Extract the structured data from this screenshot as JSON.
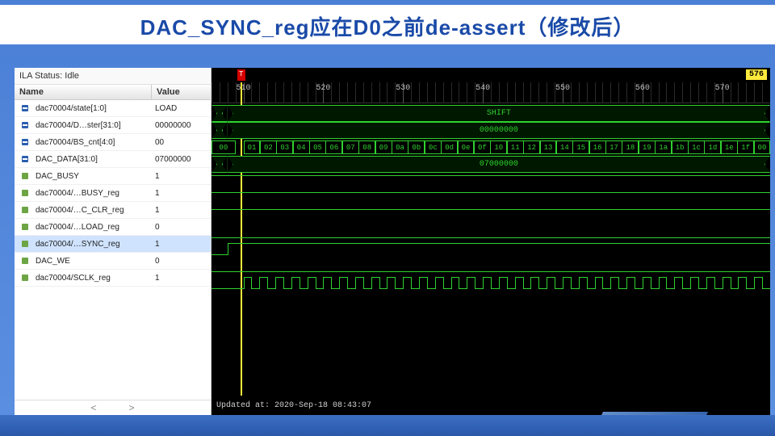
{
  "slide": {
    "title": "DAC_SYNC_reg应在D0之前de-assert（修改后）"
  },
  "ila": {
    "status_label": "ILA Status:",
    "status_value": "Idle"
  },
  "columns": {
    "name": "Name",
    "value": "Value"
  },
  "signals": [
    {
      "icon": "bus",
      "name": "dac70004/state[1:0]",
      "value": "LOAD",
      "type": "bus",
      "seg_label": "SHIFT"
    },
    {
      "icon": "bus",
      "name": "dac70004/D…ster[31:0]",
      "value": "00000000",
      "type": "bus",
      "seg_label": "00000000"
    },
    {
      "icon": "bus",
      "name": "dac70004/BS_cnt[4:0]",
      "value": "00",
      "type": "hexcount"
    },
    {
      "icon": "bus",
      "name": "DAC_DATA[31:0]",
      "value": "07000000",
      "type": "bus",
      "seg_label": "07000000"
    },
    {
      "icon": "sig",
      "name": "DAC_BUSY",
      "value": "1",
      "type": "bit",
      "level": "high"
    },
    {
      "icon": "sig",
      "name": "dac70004/…BUSY_reg",
      "value": "1",
      "type": "bit",
      "level": "high"
    },
    {
      "icon": "sig",
      "name": "dac70004/…C_CLR_reg",
      "value": "1",
      "type": "bit",
      "level": "high"
    },
    {
      "icon": "sig",
      "name": "dac70004/…LOAD_reg",
      "value": "0",
      "type": "bit",
      "level": "low"
    },
    {
      "icon": "sig",
      "name": "dac70004/…SYNC_reg",
      "value": "1",
      "type": "bit",
      "level": "stephigh",
      "selected": true
    },
    {
      "icon": "sig",
      "name": "DAC_WE",
      "value": "0",
      "type": "bit",
      "level": "low"
    },
    {
      "icon": "sig",
      "name": "dac70004/SCLK_reg",
      "value": "1",
      "type": "clock"
    }
  ],
  "ruler": {
    "cursor_badge": "576",
    "majors": [
      510,
      520,
      530,
      540,
      550,
      560,
      570
    ]
  },
  "hexcount": {
    "first": "00",
    "values": [
      "01",
      "02",
      "03",
      "04",
      "05",
      "06",
      "07",
      "08",
      "09",
      "0a",
      "0b",
      "0c",
      "0d",
      "0e",
      "0f",
      "10",
      "11",
      "12",
      "13",
      "14",
      "15",
      "16",
      "17",
      "18",
      "19",
      "1a",
      "1b",
      "1c",
      "1d",
      "1e",
      "1f",
      "00"
    ]
  },
  "updated": {
    "prefix": "Updated at:",
    "ts": "2020-Sep-18 08:43:07"
  },
  "scroll": {
    "left": "<",
    "right": ">"
  }
}
